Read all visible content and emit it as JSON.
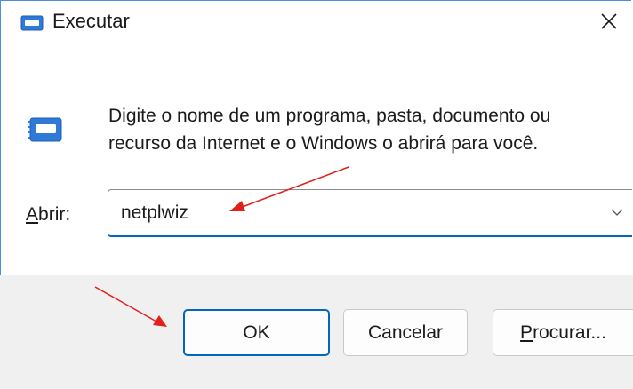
{
  "window": {
    "title": "Executar",
    "accent_color": "#0067c0",
    "icons": {
      "title": "run-dialog-icon",
      "close": "close-icon",
      "big": "run-dialog-icon",
      "dropdown": "chevron-down-icon"
    }
  },
  "description": {
    "line1": "Digite o nome de um programa, pasta, documento ou",
    "line2": "recurso da Internet e o Windows o abrirá para você."
  },
  "open_field": {
    "label_accel": "A",
    "label_rest": "brir:",
    "value": "netplwiz"
  },
  "buttons": {
    "ok": "OK",
    "cancel": "Cancelar",
    "browse_accel": "P",
    "browse_rest": "rocurar..."
  },
  "annotations": {
    "arrow_color": "#e0201b",
    "targets": [
      "open-field",
      "ok-button"
    ]
  }
}
